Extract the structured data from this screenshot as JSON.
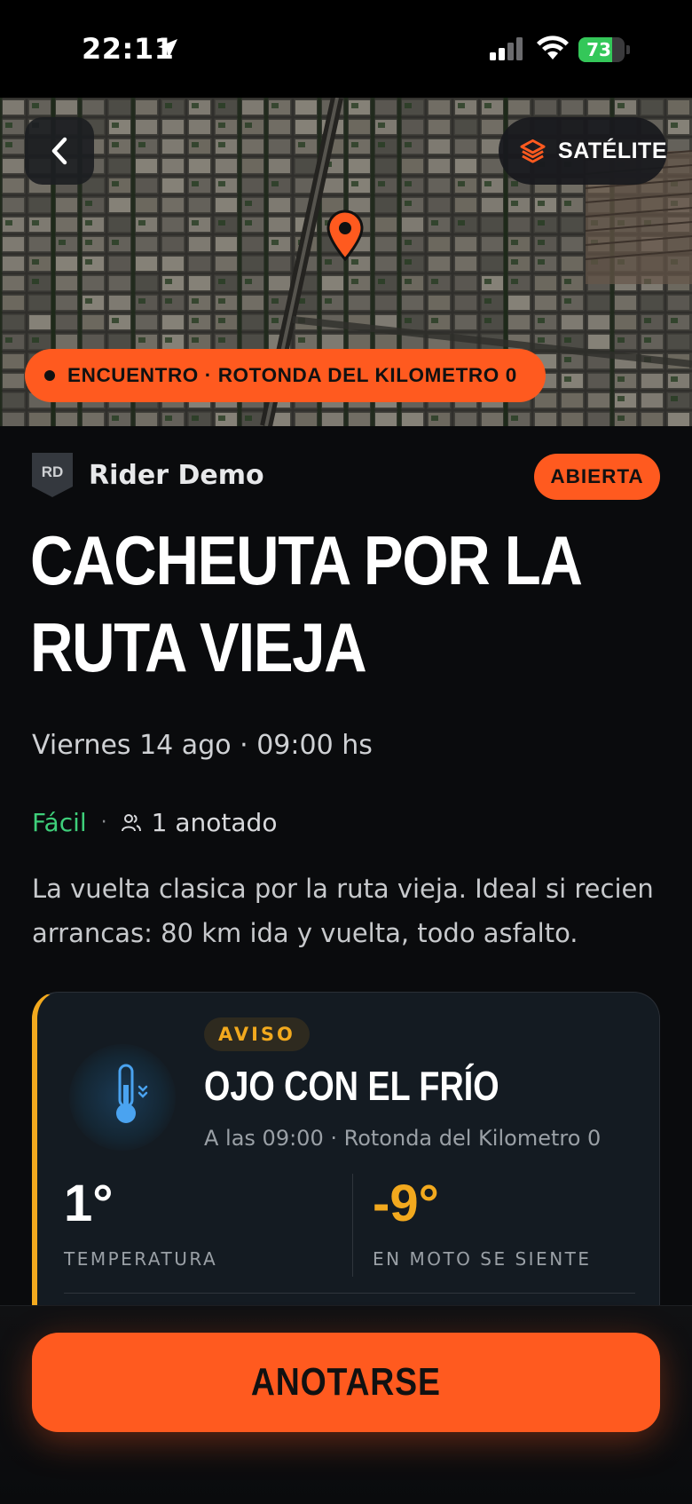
{
  "status_bar": {
    "time": "22:11",
    "battery_level": "73",
    "battery_fraction": 0.73,
    "location_icon": "location-arrow-icon",
    "signal_icon": "cellular-signal-icon",
    "wifi_icon": "wifi-icon",
    "battery_color": "#34c759"
  },
  "map": {
    "back_icon": "chevron-left-icon",
    "layer_toggle_label": "SATÉLITE",
    "layer_icon": "layers-icon",
    "pin_icon": "map-pin-icon",
    "meeting_point_label": "ENCUENTRO · ROTONDA DEL KILOMETRO 0"
  },
  "ride": {
    "organizer_initials": "RD",
    "organizer_name": "Rider Demo",
    "status_badge": "ABIERTA",
    "title": "CACHEUTA POR LA RUTA VIEJA",
    "date_time": "Viernes 14 ago · 09:00 hs",
    "difficulty": "Fácil",
    "separator": "·",
    "participants_icon": "people-icon",
    "participants": "1 anotado",
    "description": "La vuelta clasica por la ruta vieja. Ideal si recien arrancas: 80 km ida y vuelta, todo asfalto."
  },
  "weather_alert": {
    "icon": "thermometer-cold-icon",
    "tag": "AVISO",
    "title": "OJO CON EL FRÍO",
    "subtitle": "A las 09:00 · Rotonda del Kilometro 0",
    "temperature_value": "1°",
    "temperature_label": "TEMPERATURA",
    "feels_like_value": "-9°",
    "feels_like_label": "EN MOTO SE SIENTE"
  },
  "actions": {
    "join_label": "ANOTARSE"
  },
  "colors": {
    "accent": "#ff5a1f",
    "warning": "#f2a91e",
    "easy": "#3ecf7a",
    "background": "#0a0b0d"
  }
}
